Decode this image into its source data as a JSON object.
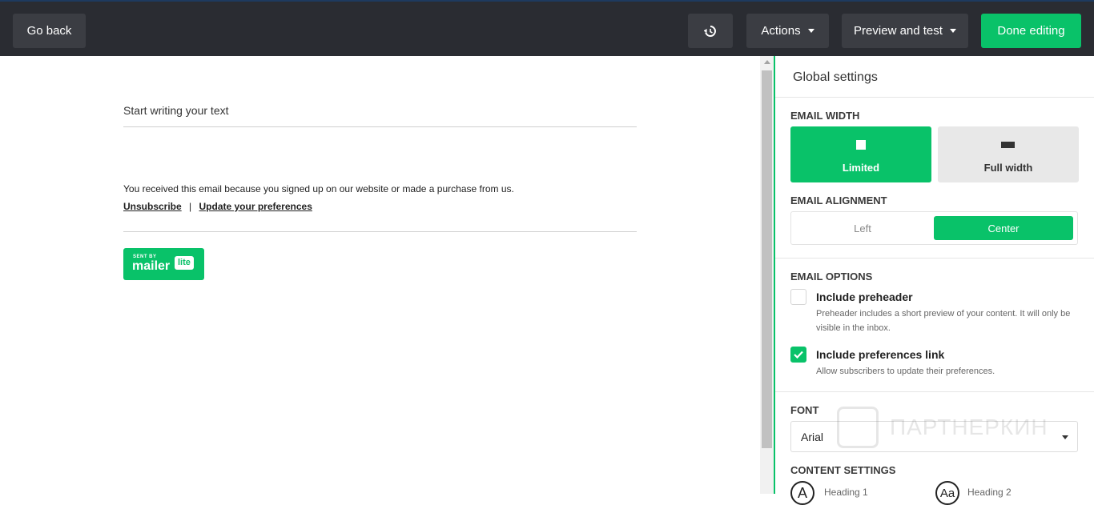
{
  "toolbar": {
    "back_label": "Go back",
    "history_icon": "history-icon",
    "actions_label": "Actions",
    "preview_label": "Preview and test",
    "done_label": "Done editing",
    "accent_color": "#09c269",
    "bar_color": "#2a2c32"
  },
  "canvas": {
    "start_text": "Start writing your text",
    "footer_text": "You received this email because you signed up on our website or made a purchase from us.",
    "unsubscribe": "Unsubscribe",
    "separator": "|",
    "update_prefs": "Update your preferences",
    "badge": {
      "sent_by": "SENT BY",
      "mailer": "mailer",
      "lite": "lite"
    }
  },
  "panel": {
    "title": "Global settings",
    "email_width": {
      "label": "EMAIL WIDTH",
      "options": [
        "Limited",
        "Full width"
      ],
      "selected": "Limited"
    },
    "email_alignment": {
      "label": "EMAIL ALIGNMENT",
      "options": [
        "Left",
        "Center"
      ],
      "selected": "Center"
    },
    "email_options": {
      "label": "EMAIL OPTIONS",
      "preheader": {
        "title": "Include preheader",
        "desc": "Preheader includes a short preview of your content. It will only be visible in the inbox.",
        "checked": false
      },
      "prefs_link": {
        "title": "Include preferences link",
        "desc": "Allow subscribers to update their preferences.",
        "checked": true
      }
    },
    "font": {
      "label": "FONT",
      "value": "Arial"
    },
    "content_settings": {
      "label": "CONTENT SETTINGS",
      "items": [
        {
          "glyph": "A",
          "label": "Heading 1"
        },
        {
          "glyph": "Aa",
          "label": "Heading 2"
        }
      ]
    }
  },
  "watermark": "ПАРТНЕРКИН"
}
